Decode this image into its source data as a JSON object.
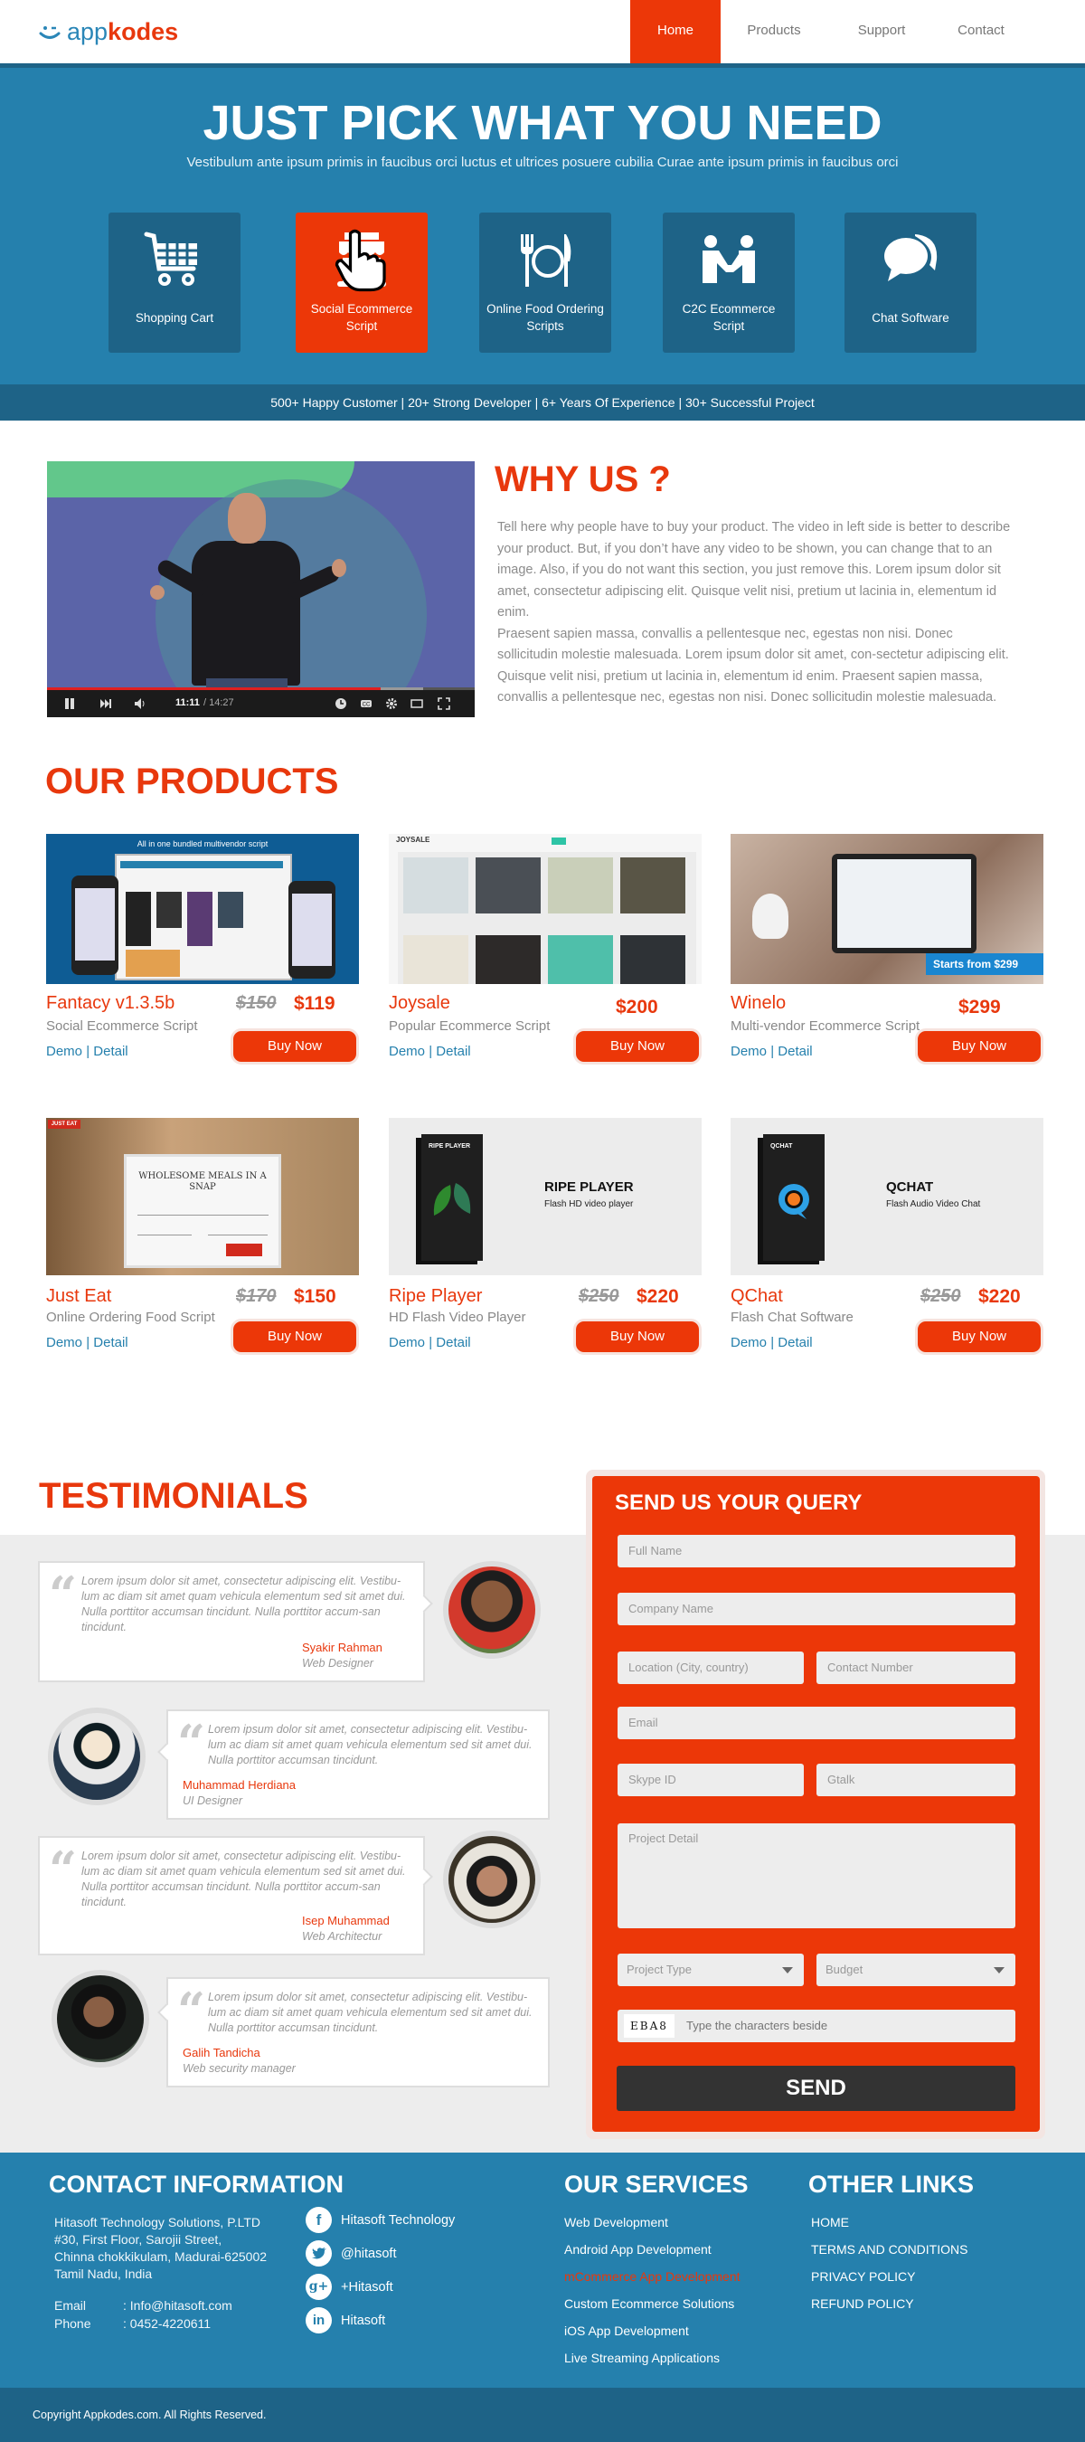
{
  "header": {
    "logo": {
      "prefix": "app",
      "suffix": "kodes"
    },
    "nav": [
      {
        "label": "Home",
        "active": true
      },
      {
        "label": "Products",
        "active": false
      },
      {
        "label": "Support",
        "active": false
      },
      {
        "label": "Contact",
        "active": false
      }
    ]
  },
  "hero": {
    "title": "JUST PICK WHAT YOU  NEED",
    "subtitle": "Vestibulum ante ipsum primis in faucibus orci luctus et ultrices posuere cubilia Curae ante ipsum primis in faucibus orci",
    "tiles": [
      {
        "label": "Shopping Cart",
        "icon": "shopping-cart-icon",
        "active": false
      },
      {
        "label": "Social Ecommerce Script",
        "icon": "storefront-icon",
        "active": true
      },
      {
        "label": "Online Food Ordering Scripts",
        "icon": "fork-plate-knife-icon",
        "active": false
      },
      {
        "label": "C2C Ecommerce Script",
        "icon": "handshake-people-icon",
        "active": false
      },
      {
        "label": "Chat Software",
        "icon": "chat-bubbles-icon",
        "active": false
      }
    ],
    "stats": "500+ Happy Customer | 20+ Strong Developer | 6+ Years Of Experience | 30+ Successful Project"
  },
  "why_us": {
    "title": "WHY US ?",
    "video": {
      "current_time": "11:11",
      "duration": "/ 14:27",
      "progress_fraction": 0.78,
      "buffered_fraction": 0.88
    },
    "paragraphs": [
      "Tell here why people have to buy your product. The video in left side is better to describe your product. But, if you don’t have any video to be shown, you can change that to an image. Also, if you do not want this section, you just remove this. Lorem ipsum dolor sit amet, consectetur adipiscing elit. Quisque velit nisi, pretium ut lacinia in, elementum id enim.",
      "Praesent sapien massa, convallis a pellentesque nec, egestas non nisi. Donec sollicitudin molestie malesuada. Lorem ipsum dolor sit amet, con-sectetur adipiscing elit. Quisque velit nisi, pretium ut lacinia in, elementum id enim. Praesent sapien massa, convallis a pellentesque nec, egestas non nisi. Donec sollicitudin molestie malesuada."
    ]
  },
  "products": {
    "title": "OUR PRODUCTS",
    "demo_label": "Demo",
    "detail_label": "Detail",
    "separator": "|",
    "buy_label": "Buy Now",
    "items": [
      {
        "name": "Fantacy v1.3.5b",
        "subtitle": "Social Ecommerce Script",
        "old_price": "$150",
        "price": "$119",
        "image_caption": "All in one bundled multivendor script"
      },
      {
        "name": "Joysale",
        "subtitle": "Popular Ecommerce Script",
        "old_price": "",
        "price": "$200",
        "image_caption": "JOYSALE"
      },
      {
        "name": "Winelo",
        "subtitle": "Multi-vendor Ecommerce Script",
        "old_price": "",
        "price": "$299",
        "image_caption": "Starts from $299"
      },
      {
        "name": "Just Eat",
        "subtitle": "Online Ordering Food Script",
        "old_price": "$170",
        "price": "$150",
        "image_caption": "WHOLESOME MEALS IN A SNAP"
      },
      {
        "name": "Ripe Player",
        "subtitle": "HD Flash Video Player",
        "old_price": "$250",
        "price": "$220",
        "image_caption": "RIPE PLAYER",
        "image_subcaption": "Flash HD video player"
      },
      {
        "name": "QChat",
        "subtitle": "Flash Chat Software",
        "old_price": "$250",
        "price": "$220",
        "image_caption": "QCHAT",
        "image_subcaption": "Flash Audio Video Chat"
      }
    ]
  },
  "testimonials": {
    "title": "TESTIMONIALS",
    "items": [
      {
        "text": "Lorem ipsum dolor sit amet, consectetur adipiscing elit. Vestibu-lum ac diam sit amet quam vehicula elementum sed sit amet dui. Nulla porttitor accumsan tincidunt. Nulla porttitor accum-san tincidunt.",
        "name": "Syakir Rahman",
        "role": "Web Designer"
      },
      {
        "text": "Lorem ipsum dolor sit amet, consectetur adipiscing elit. Vestibu-lum ac diam sit amet quam vehicula elementum sed sit amet dui. Nulla porttitor accumsan tincidunt.",
        "name": "Muhammad Herdiana",
        "role": "UI Designer"
      },
      {
        "text": "Lorem ipsum dolor sit amet, consectetur adipiscing elit. Vestibu-lum ac diam sit amet quam vehicula elementum sed sit amet dui. Nulla porttitor accumsan tincidunt. Nulla porttitor accum-san tincidunt.",
        "name": "Isep Muhammad",
        "role": "Web Architectur"
      },
      {
        "text": "Lorem ipsum dolor sit amet, consectetur adipiscing elit. Vestibu-lum ac diam sit amet quam vehicula elementum sed sit amet dui. Nulla porttitor accumsan tincidunt.",
        "name": "Galih Tandicha",
        "role": "Web security manager"
      }
    ]
  },
  "query_form": {
    "title": "SEND US YOUR QUERY",
    "full_name_placeholder": "Full Name",
    "company_placeholder": "Company Name",
    "location_placeholder": "Location (City, country)",
    "contact_placeholder": "Contact Number",
    "email_placeholder": "Email",
    "skype_placeholder": "Skype ID",
    "gtalk_placeholder": "Gtalk",
    "project_detail_placeholder": "Project Detail",
    "project_type_selected": "Project Type",
    "budget_selected": "Budget",
    "captcha_text": "EBA8",
    "captcha_placeholder": "Type the characters beside",
    "send_label": "SEND"
  },
  "footer": {
    "contact": {
      "title": "CONTACT INFORMATION",
      "address": [
        "Hitasoft Technology Solutions, P.LTD",
        "#30, First Floor, Sarojii Street,",
        "Chinna chokkikulam, Madurai-625002",
        "Tamil Nadu, India"
      ],
      "email_label": "Email",
      "email": ": Info@hitasoft.com",
      "phone_label": "Phone",
      "phone": ": 0452-4220611"
    },
    "social": [
      {
        "icon": "facebook-icon",
        "glyph": "f",
        "label": "Hitasoft Technology"
      },
      {
        "icon": "twitter-icon",
        "glyph": "t",
        "label": "@hitasoft"
      },
      {
        "icon": "google-plus-icon",
        "glyph": "g+",
        "label": "+Hitasoft"
      },
      {
        "icon": "linkedin-icon",
        "glyph": "in",
        "label": "Hitasoft"
      }
    ],
    "services": {
      "title": "OUR SERVICES",
      "items": [
        "Web Development",
        "Android App Development",
        "mCommerce App Development",
        "Custom Ecommerce Solutions",
        "iOS App Development",
        "Live Streaming Applications"
      ],
      "highlighted_index": 2
    },
    "links": {
      "title": "OTHER LINKS",
      "items": [
        "HOME",
        "TERMS AND CONDITIONS",
        "PRIVACY POLICY",
        "REFUND POLICY"
      ]
    },
    "copyright": "Copyright Appkodes.com. All Rights Reserved."
  },
  "colors": {
    "primary_blue": "#2580ad",
    "dark_blue": "#1e6387",
    "accent_orange": "#ec3708",
    "gray_bg": "#ededed"
  }
}
